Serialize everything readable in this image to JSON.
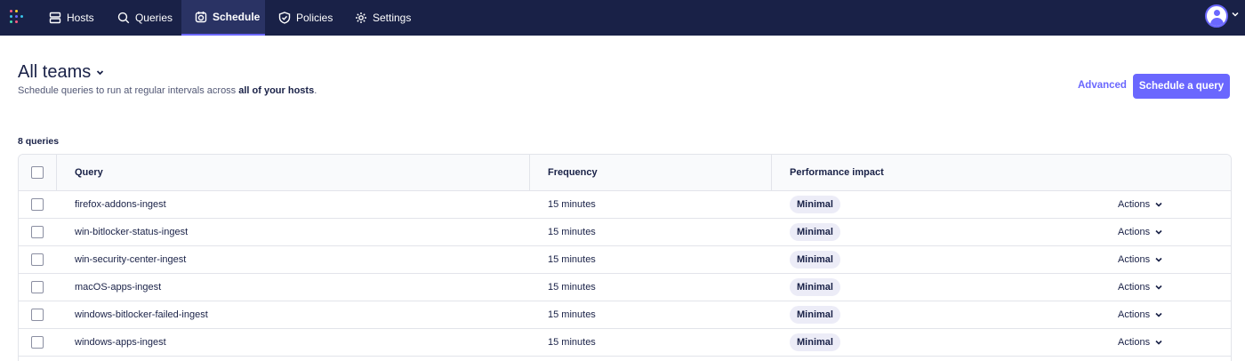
{
  "nav": {
    "items": [
      {
        "label": "Hosts",
        "icon": "hosts-icon"
      },
      {
        "label": "Queries",
        "icon": "queries-icon"
      },
      {
        "label": "Schedule",
        "icon": "schedule-icon"
      },
      {
        "label": "Policies",
        "icon": "policies-icon"
      },
      {
        "label": "Settings",
        "icon": "settings-icon"
      }
    ],
    "active": "Schedule",
    "colors": {
      "background": "#192147",
      "accent": "#6a67fe"
    }
  },
  "header": {
    "title": "All teams",
    "subtitle_pre": "Schedule queries to run at regular intervals across ",
    "subtitle_bold": "all of your hosts",
    "subtitle_post": ".",
    "advanced_label": "Advanced",
    "primary_label": "Schedule a query"
  },
  "table": {
    "count_label": "8 queries",
    "columns": [
      "Query",
      "Frequency",
      "Performance impact"
    ],
    "actions_label": "Actions",
    "rows": [
      {
        "query": "firefox-addons-ingest",
        "frequency": "15 minutes",
        "impact": "Minimal"
      },
      {
        "query": "win-bitlocker-status-ingest",
        "frequency": "15 minutes",
        "impact": "Minimal"
      },
      {
        "query": "win-security-center-ingest",
        "frequency": "15 minutes",
        "impact": "Minimal"
      },
      {
        "query": "macOS-apps-ingest",
        "frequency": "15 minutes",
        "impact": "Minimal"
      },
      {
        "query": "windows-bitlocker-failed-ingest",
        "frequency": "15 minutes",
        "impact": "Minimal"
      },
      {
        "query": "windows-apps-ingest",
        "frequency": "15 minutes",
        "impact": "Minimal"
      }
    ]
  }
}
